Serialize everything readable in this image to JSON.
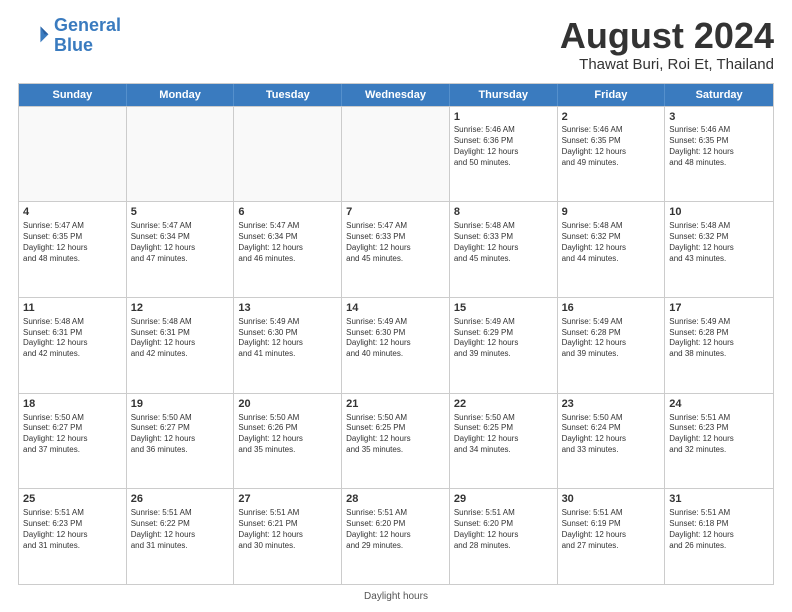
{
  "header": {
    "logo_line1": "General",
    "logo_line2": "Blue",
    "month": "August 2024",
    "location": "Thawat Buri, Roi Et, Thailand"
  },
  "days_of_week": [
    "Sunday",
    "Monday",
    "Tuesday",
    "Wednesday",
    "Thursday",
    "Friday",
    "Saturday"
  ],
  "footer": "Daylight hours",
  "weeks": [
    [
      {
        "day": "",
        "info": ""
      },
      {
        "day": "",
        "info": ""
      },
      {
        "day": "",
        "info": ""
      },
      {
        "day": "",
        "info": ""
      },
      {
        "day": "1",
        "info": "Sunrise: 5:46 AM\nSunset: 6:36 PM\nDaylight: 12 hours\nand 50 minutes."
      },
      {
        "day": "2",
        "info": "Sunrise: 5:46 AM\nSunset: 6:35 PM\nDaylight: 12 hours\nand 49 minutes."
      },
      {
        "day": "3",
        "info": "Sunrise: 5:46 AM\nSunset: 6:35 PM\nDaylight: 12 hours\nand 48 minutes."
      }
    ],
    [
      {
        "day": "4",
        "info": "Sunrise: 5:47 AM\nSunset: 6:35 PM\nDaylight: 12 hours\nand 48 minutes."
      },
      {
        "day": "5",
        "info": "Sunrise: 5:47 AM\nSunset: 6:34 PM\nDaylight: 12 hours\nand 47 minutes."
      },
      {
        "day": "6",
        "info": "Sunrise: 5:47 AM\nSunset: 6:34 PM\nDaylight: 12 hours\nand 46 minutes."
      },
      {
        "day": "7",
        "info": "Sunrise: 5:47 AM\nSunset: 6:33 PM\nDaylight: 12 hours\nand 45 minutes."
      },
      {
        "day": "8",
        "info": "Sunrise: 5:48 AM\nSunset: 6:33 PM\nDaylight: 12 hours\nand 45 minutes."
      },
      {
        "day": "9",
        "info": "Sunrise: 5:48 AM\nSunset: 6:32 PM\nDaylight: 12 hours\nand 44 minutes."
      },
      {
        "day": "10",
        "info": "Sunrise: 5:48 AM\nSunset: 6:32 PM\nDaylight: 12 hours\nand 43 minutes."
      }
    ],
    [
      {
        "day": "11",
        "info": "Sunrise: 5:48 AM\nSunset: 6:31 PM\nDaylight: 12 hours\nand 42 minutes."
      },
      {
        "day": "12",
        "info": "Sunrise: 5:48 AM\nSunset: 6:31 PM\nDaylight: 12 hours\nand 42 minutes."
      },
      {
        "day": "13",
        "info": "Sunrise: 5:49 AM\nSunset: 6:30 PM\nDaylight: 12 hours\nand 41 minutes."
      },
      {
        "day": "14",
        "info": "Sunrise: 5:49 AM\nSunset: 6:30 PM\nDaylight: 12 hours\nand 40 minutes."
      },
      {
        "day": "15",
        "info": "Sunrise: 5:49 AM\nSunset: 6:29 PM\nDaylight: 12 hours\nand 39 minutes."
      },
      {
        "day": "16",
        "info": "Sunrise: 5:49 AM\nSunset: 6:28 PM\nDaylight: 12 hours\nand 39 minutes."
      },
      {
        "day": "17",
        "info": "Sunrise: 5:49 AM\nSunset: 6:28 PM\nDaylight: 12 hours\nand 38 minutes."
      }
    ],
    [
      {
        "day": "18",
        "info": "Sunrise: 5:50 AM\nSunset: 6:27 PM\nDaylight: 12 hours\nand 37 minutes."
      },
      {
        "day": "19",
        "info": "Sunrise: 5:50 AM\nSunset: 6:27 PM\nDaylight: 12 hours\nand 36 minutes."
      },
      {
        "day": "20",
        "info": "Sunrise: 5:50 AM\nSunset: 6:26 PM\nDaylight: 12 hours\nand 35 minutes."
      },
      {
        "day": "21",
        "info": "Sunrise: 5:50 AM\nSunset: 6:25 PM\nDaylight: 12 hours\nand 35 minutes."
      },
      {
        "day": "22",
        "info": "Sunrise: 5:50 AM\nSunset: 6:25 PM\nDaylight: 12 hours\nand 34 minutes."
      },
      {
        "day": "23",
        "info": "Sunrise: 5:50 AM\nSunset: 6:24 PM\nDaylight: 12 hours\nand 33 minutes."
      },
      {
        "day": "24",
        "info": "Sunrise: 5:51 AM\nSunset: 6:23 PM\nDaylight: 12 hours\nand 32 minutes."
      }
    ],
    [
      {
        "day": "25",
        "info": "Sunrise: 5:51 AM\nSunset: 6:23 PM\nDaylight: 12 hours\nand 31 minutes."
      },
      {
        "day": "26",
        "info": "Sunrise: 5:51 AM\nSunset: 6:22 PM\nDaylight: 12 hours\nand 31 minutes."
      },
      {
        "day": "27",
        "info": "Sunrise: 5:51 AM\nSunset: 6:21 PM\nDaylight: 12 hours\nand 30 minutes."
      },
      {
        "day": "28",
        "info": "Sunrise: 5:51 AM\nSunset: 6:20 PM\nDaylight: 12 hours\nand 29 minutes."
      },
      {
        "day": "29",
        "info": "Sunrise: 5:51 AM\nSunset: 6:20 PM\nDaylight: 12 hours\nand 28 minutes."
      },
      {
        "day": "30",
        "info": "Sunrise: 5:51 AM\nSunset: 6:19 PM\nDaylight: 12 hours\nand 27 minutes."
      },
      {
        "day": "31",
        "info": "Sunrise: 5:51 AM\nSunset: 6:18 PM\nDaylight: 12 hours\nand 26 minutes."
      }
    ]
  ]
}
